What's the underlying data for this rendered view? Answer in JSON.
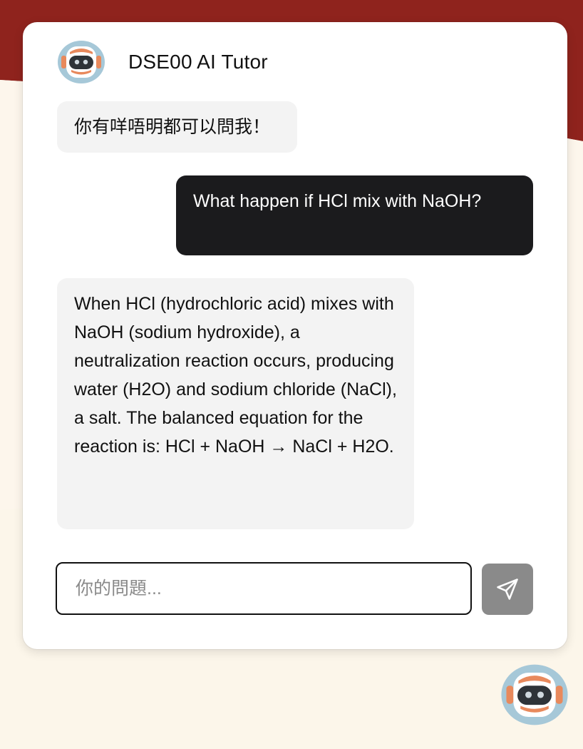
{
  "header": {
    "title": "DSE00 AI Tutor",
    "avatar_icon": "robot-icon"
  },
  "messages": [
    {
      "role": "bot",
      "text": "你有咩唔明都可以問我！"
    },
    {
      "role": "user",
      "text": "What happen if HCl mix with NaOH?"
    },
    {
      "role": "bot",
      "text": "When HCl (hydrochloric acid) mixes with NaOH (sodium hydroxide), a neutralization reaction occurs, producing water (H2O) and sodium chloride (NaCl), a salt. The balanced equation for the reaction is: HCl + NaOH → NaCl + H2O."
    }
  ],
  "composer": {
    "placeholder": "你的問題...",
    "value": "",
    "send_icon": "paper-plane-icon"
  },
  "launcher": {
    "icon": "robot-icon"
  },
  "colors": {
    "banner": "#8f231d",
    "page_background": "#fcf6ea",
    "user_bubble": "#1b1b1d",
    "bot_bubble": "#f3f3f3",
    "send_button": "#8a8a8a",
    "robot_accent": "#e8895c",
    "robot_ring": "#a6c8d8"
  }
}
